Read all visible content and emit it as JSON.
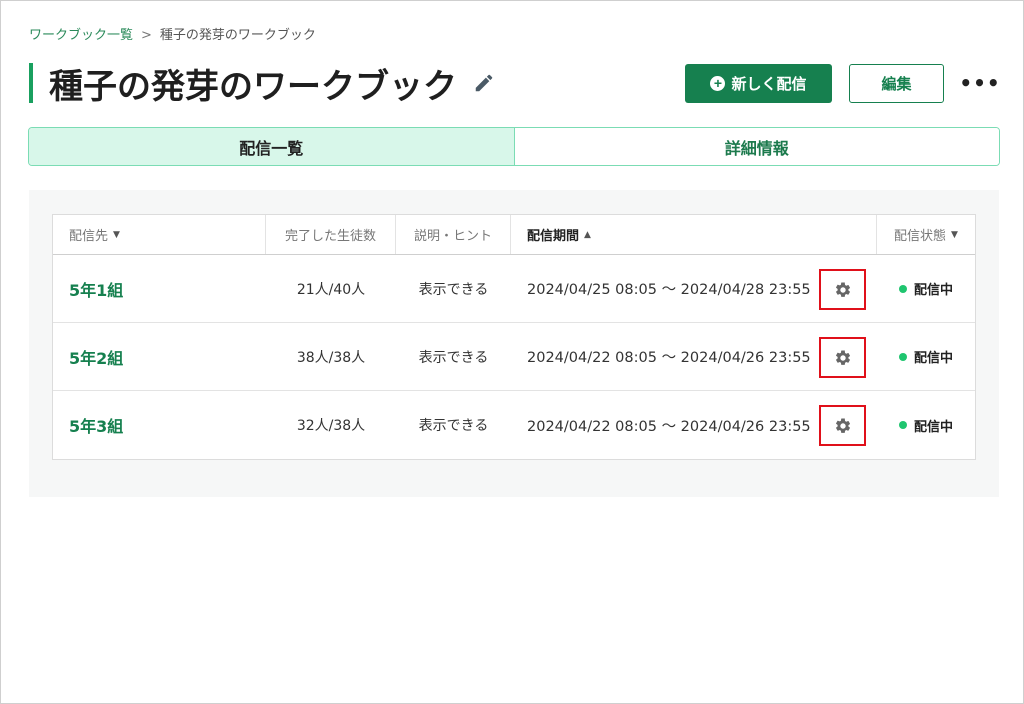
{
  "breadcrumb": {
    "parent": "ワークブック一覧",
    "separator": ">",
    "current": "種子の発芽のワークブック"
  },
  "header": {
    "title": "種子の発芽のワークブック",
    "new_delivery_label": "新しく配信",
    "edit_label": "編集",
    "more_label": "•••"
  },
  "tabs": [
    {
      "label": "配信一覧",
      "active": true
    },
    {
      "label": "詳細情報",
      "active": false
    }
  ],
  "table": {
    "columns": {
      "target": "配信先",
      "completed": "完了した生徒数",
      "hint": "説明・ヒント",
      "period": "配信期間",
      "status": "配信状態"
    },
    "rows": [
      {
        "target": "5年1組",
        "completed": "21人/40人",
        "hint": "表示できる",
        "period": "2024/04/25 08:05 〜 2024/04/28 23:55",
        "status": "配信中"
      },
      {
        "target": "5年2組",
        "completed": "38人/38人",
        "hint": "表示できる",
        "period": "2024/04/22 08:05 〜 2024/04/26 23:55",
        "status": "配信中"
      },
      {
        "target": "5年3組",
        "completed": "32人/38人",
        "hint": "表示できる",
        "period": "2024/04/22 08:05 〜 2024/04/26 23:55",
        "status": "配信中"
      }
    ]
  },
  "colors": {
    "brand": "#16804f",
    "accent": "#19a05f",
    "status_active": "#1fc56f",
    "highlight_box": "#e0101a"
  },
  "icons": {
    "edit": "pencil-icon",
    "add": "plus-circle-icon",
    "more": "more-dots-icon",
    "settings": "gear-icon",
    "sort": "caret-icon"
  }
}
